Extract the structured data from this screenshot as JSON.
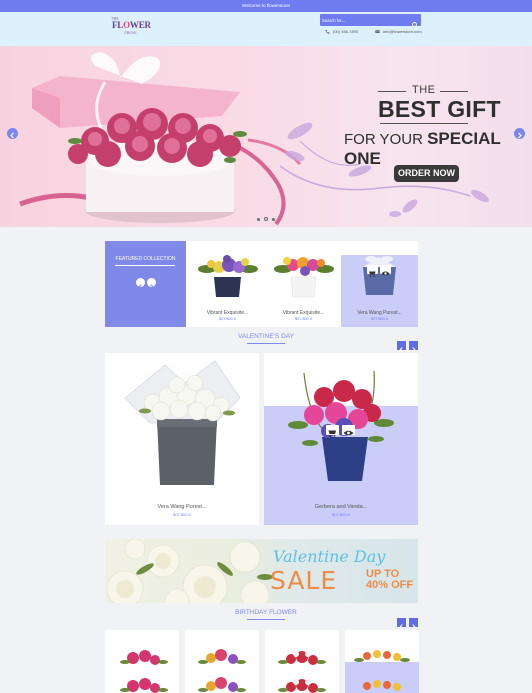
{
  "topbar": {
    "welcome": "Welcome to flowerstore!"
  },
  "header": {
    "logo": {
      "line1": "THE",
      "line2a": "FL",
      "line2b": "O",
      "line2c": "WER",
      "line3": "GROVE"
    },
    "search": {
      "placeholder": "Search for..."
    },
    "phone": "(00) 456-7890",
    "email": "info@flowerstore.com"
  },
  "hero": {
    "line1": "THE",
    "line2": "BEST GIFT",
    "line3a": "FOR YOUR ",
    "line3b": "SPECIAL ONE",
    "cta": "ORDER NOW",
    "slide_count": 3,
    "active_slide": 2
  },
  "featured": {
    "title": "FEATURED COLLECTION",
    "products": [
      {
        "name": "Vibrant Exquisite...",
        "price": "$07.$00.0"
      },
      {
        "name": "Vibrant Exquisite...",
        "price": "$07.$00.0"
      },
      {
        "name": "Vera Wang Purest...",
        "price": "$07.$00.0"
      }
    ]
  },
  "valentines": {
    "title": "VALENTINE'S DAY",
    "products": [
      {
        "name": "Vera Wang Purest...",
        "price": "$07.$00.0"
      },
      {
        "name": "Gerbera and Vanda...",
        "price": "$07.$00.0"
      }
    ]
  },
  "banner": {
    "script": "Valentine Day",
    "sale": "SALE",
    "upto": "UP TO",
    "off": "40% OFF"
  },
  "birthday": {
    "title": "BIRTHDAY FLOWER"
  },
  "colors": {
    "accent": "#6f7cf0",
    "highlight": "#c9cdf8",
    "header_bg": "#dcf1fb",
    "sale_orange": "#f08a47"
  },
  "icons": [
    "search-icon",
    "phone-icon",
    "mail-icon",
    "chevron-left-icon",
    "chevron-right-icon",
    "cart-icon",
    "eye-icon"
  ]
}
